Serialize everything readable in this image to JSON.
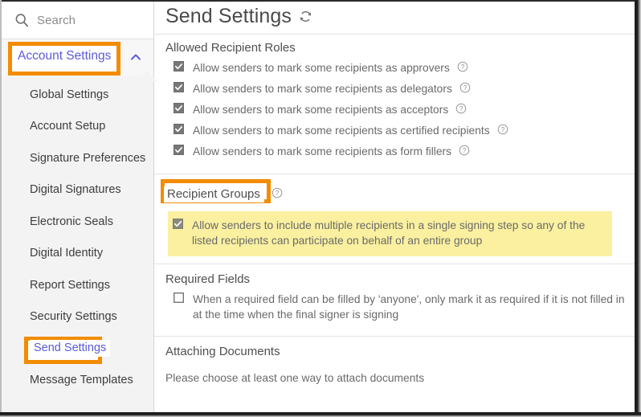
{
  "sidebar": {
    "search": {
      "placeholder": "Search",
      "icon": "search-icon"
    },
    "account_settings": {
      "label": "Account Settings",
      "expanded_icon": "chevron-up-icon",
      "highlighted": true
    },
    "items": [
      {
        "label": "Global Settings",
        "selected": false
      },
      {
        "label": "Account Setup",
        "selected": false
      },
      {
        "label": "Signature Preferences",
        "selected": false
      },
      {
        "label": "Digital Signatures",
        "selected": false
      },
      {
        "label": "Electronic Seals",
        "selected": false
      },
      {
        "label": "Digital Identity",
        "selected": false
      },
      {
        "label": "Report Settings",
        "selected": false
      },
      {
        "label": "Security Settings",
        "selected": false
      },
      {
        "label": "Send Settings",
        "selected": true
      },
      {
        "label": "Message Templates",
        "selected": false
      }
    ]
  },
  "main": {
    "title": "Send Settings",
    "refresh_icon": "refresh-icon",
    "sections": [
      {
        "heading": "Allowed Recipient Roles",
        "options": [
          {
            "label": "Allow senders to mark some recipients as approvers",
            "checked": true,
            "help": "?"
          },
          {
            "label": "Allow senders to mark some recipients as delegators",
            "checked": true,
            "help": "?"
          },
          {
            "label": "Allow senders to mark some recipients as acceptors",
            "checked": true,
            "help": "?"
          },
          {
            "label": "Allow senders to mark some recipients as certified recipients",
            "checked": true,
            "help": "?"
          },
          {
            "label": "Allow senders to mark some recipients as form fillers",
            "checked": true,
            "help": "?"
          }
        ]
      },
      {
        "heading": "Recipient Groups",
        "heading_highlighted": true,
        "heading_help": "?",
        "options": [
          {
            "label": "Allow senders to include multiple recipients in a single signing step so any of the listed recipients can participate on behalf of an entire group",
            "checked": true,
            "highlighted": true
          }
        ]
      },
      {
        "heading": "Required Fields",
        "options": [
          {
            "label": "When a required field can be filled by 'anyone', only mark it as required if it is not filled in at the time when the final signer is signing",
            "checked": false
          }
        ]
      },
      {
        "heading": "Attaching Documents",
        "note": "Please choose at least one way to attach documents"
      }
    ]
  },
  "colors": {
    "annotation_orange": "#f28c00",
    "highlight_yellow": "#faf0a0",
    "link_blue": "#5b5bd6",
    "sidebar_bg": "#f3f3f3",
    "text_gray": "#6a6a6a"
  }
}
